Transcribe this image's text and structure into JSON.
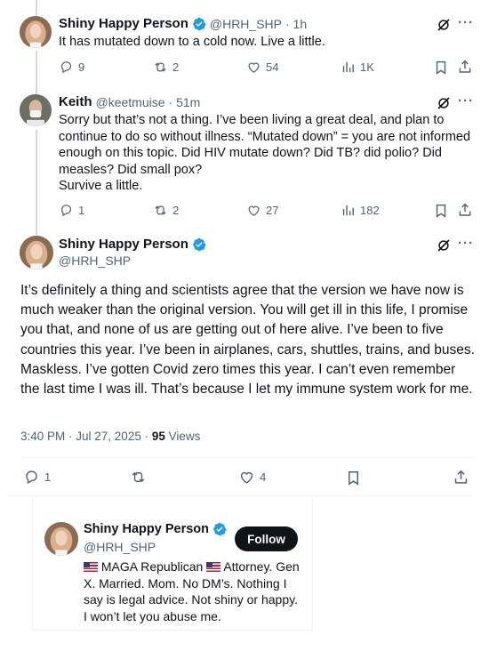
{
  "replies": [
    {
      "name": "Shiny Happy Person",
      "handle": "@HRH_SHP",
      "time": "· 1h",
      "text": "It has mutated down to a cold now. Live a little.",
      "stats": {
        "replies": "9",
        "reposts": "2",
        "likes": "54",
        "views": "1K"
      }
    },
    {
      "name": "Keith",
      "handle": "@keetmuise",
      "time": "· 51m",
      "text": "Sorry but that’s not a thing. I’ve been living a great deal, and plan to continue to do so without illness. “Mutated down” = you are not informed enough on this topic. Did HIV mutate down? Did TB? did polio? Did measles? Did small pox?\nSurvive a little.",
      "stats": {
        "replies": "1",
        "reposts": "2",
        "likes": "27",
        "views": "182"
      }
    }
  ],
  "main_post": {
    "name": "Shiny Happy Person",
    "handle": "@HRH_SHP",
    "text": "It’s definitely a thing and scientists agree that the version we have now is much weaker than the original version. You will get ill in this life, I promise you that, and none of us are getting out of here alive. I’ve been to five countries this year. I’ve been in airplanes, cars, shuttles, trains, and buses. Maskless. I’ve gotten Covid zero times this year. I can’t even remember the last time I was ill. That’s because I let my immune system work for me.",
    "timestamp": "3:40 PM · Jul 27, 2025 ·",
    "views_count": "95",
    "views_label": "Views",
    "stats": {
      "replies": "1",
      "likes": "4"
    }
  },
  "hover_card": {
    "name": "Shiny Happy Person",
    "handle": "@HRH_SHP",
    "follow_label": "Follow",
    "bio_line1_a": "MAGA Republican",
    "bio_line1_b": "Attorney.",
    "bio_rest": "Gen X. Married. Mom. No DM’s. Nothing I say is legal advice. Not shiny or happy. I won’t let you abuse me."
  },
  "colors": {
    "verified": "#1d9bf0",
    "muted": "#536471",
    "text": "#0f1419",
    "divider": "#eff3f4"
  },
  "icons": [
    "verified-badge-icon",
    "grok-icon",
    "more-icon",
    "reply-icon",
    "repost-icon",
    "like-icon",
    "views-icon",
    "bookmark-icon",
    "share-icon",
    "flag-us-icon"
  ]
}
